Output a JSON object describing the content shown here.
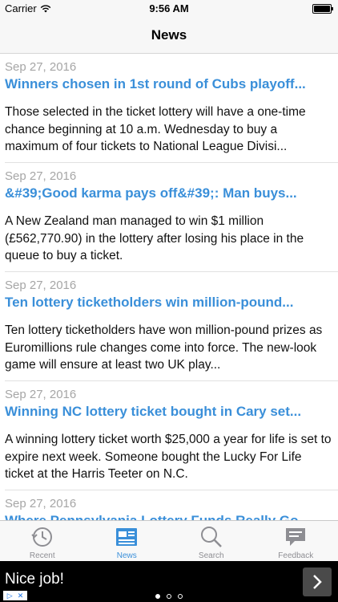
{
  "status_bar": {
    "carrier": "Carrier",
    "time": "9:56 AM"
  },
  "nav": {
    "title": "News"
  },
  "news": [
    {
      "date": "Sep 27, 2016",
      "title": "Winners chosen in 1st round of Cubs playoff...",
      "body": "Those selected in the ticket lottery will have a one-time chance beginning at 10 a.m. Wednesday to buy a maximum of four tickets to National League Divisi..."
    },
    {
      "date": "Sep 27, 2016",
      "title": "&#39;Good karma pays off&#39;: Man buys...",
      "body": "A New Zealand man managed to win $1 million (£562,770.90) in the lottery after losing his place in the queue to buy a ticket."
    },
    {
      "date": "Sep 27, 2016",
      "title": "Ten lottery ticketholders win million-pound...",
      "body": "Ten lottery ticketholders have won million-pound prizes as Euromillions rule changes come into force. The new-look game will ensure at least two UK play..."
    },
    {
      "date": "Sep 27, 2016",
      "title": "Winning NC lottery ticket bought in Cary set...",
      "body": "A winning lottery ticket worth $25,000 a year for life is set to expire next week. Someone bought the Lucky For Life ticket at the Harris Teeter on N.C."
    },
    {
      "date": "Sep 27, 2016",
      "title": "Where Pennsylvania Lottery Funds Really Go...",
      "body": ""
    }
  ],
  "tabs": [
    {
      "label": "Recent",
      "icon": "clock-icon"
    },
    {
      "label": "News",
      "icon": "newspaper-icon"
    },
    {
      "label": "Search",
      "icon": "search-icon"
    },
    {
      "label": "Feedback",
      "icon": "feedback-icon"
    }
  ],
  "active_tab": "News",
  "ad": {
    "text": "Nice job!"
  },
  "colors": {
    "accent": "#3a8fd9",
    "date": "#a6a6a6"
  }
}
